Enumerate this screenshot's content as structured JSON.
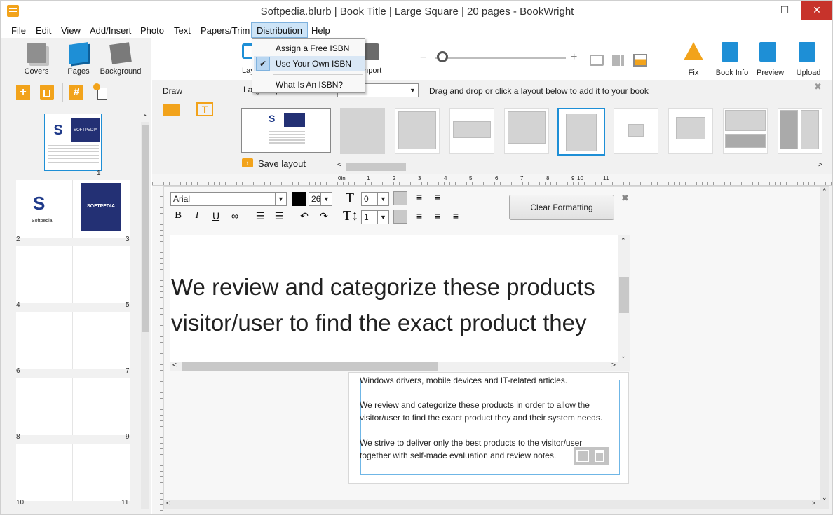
{
  "window": {
    "title": "Softpedia.blurb | Book Title | Large Square | 20 pages - BookWright",
    "minimize": "—",
    "maximize": "☐",
    "close": "✕"
  },
  "menu": [
    "File",
    "Edit",
    "View",
    "Add/Insert",
    "Photo",
    "Text",
    "Papers/Trim",
    "Distribution",
    "Help"
  ],
  "distribution_menu": {
    "items": [
      "Assign a Free ISBN",
      "Use Your Own ISBN",
      "What Is An ISBN?"
    ],
    "checked": "Use Your Own ISBN"
  },
  "left_panel": {
    "buttons": [
      "Covers",
      "Pages",
      "Background"
    ],
    "tools": [
      "add-page-icon",
      "delete-page-icon",
      "page-number-icon",
      "eyedropper-icon"
    ],
    "cover_thumb": {
      "logo": "S",
      "brand": "SOFTPEDIA"
    },
    "spread1": {
      "left_label": "Softpedia",
      "right_brand": "SOFTPEDIA"
    },
    "page_numbers": [
      "1",
      "2",
      "3",
      "4",
      "5",
      "6",
      "7",
      "8",
      "9",
      "10",
      "11"
    ]
  },
  "toolbar": {
    "left_labels": [
      "Lay",
      "Import"
    ],
    "right_buttons": [
      "Fix",
      "Book Info",
      "Preview",
      "Upload"
    ],
    "colors": {
      "accent": "#1e8fd6",
      "orange": "#f2a31b"
    }
  },
  "draw": {
    "label": "Draw"
  },
  "layouts": {
    "size_select": "Large Square",
    "hint": "Drag and drop or click a layout below to add it to your book",
    "save_label": "Save layout",
    "close": "✖"
  },
  "ruler": {
    "unit": "0in",
    "marks": [
      "1",
      "2",
      "3",
      "4",
      "5",
      "6",
      "7",
      "8",
      "9",
      "10",
      "11"
    ]
  },
  "editor": {
    "font": "Arial",
    "size": "26",
    "spacing_before": "0",
    "line_spacing": "1",
    "clear_formatting": "Clear Formatting",
    "close": "✖",
    "line1": "We review and categorize these products",
    "line2": "visitor/user to find the exact product they"
  },
  "page_text": [
    "Windows drivers, mobile devices and IT-related articles.",
    "We review and categorize these products in order to allow the",
    "visitor/user to find the exact product they and their system needs.",
    "We strive to deliver only the best products to the visitor/user",
    "together with self-made evaluation and review notes."
  ]
}
